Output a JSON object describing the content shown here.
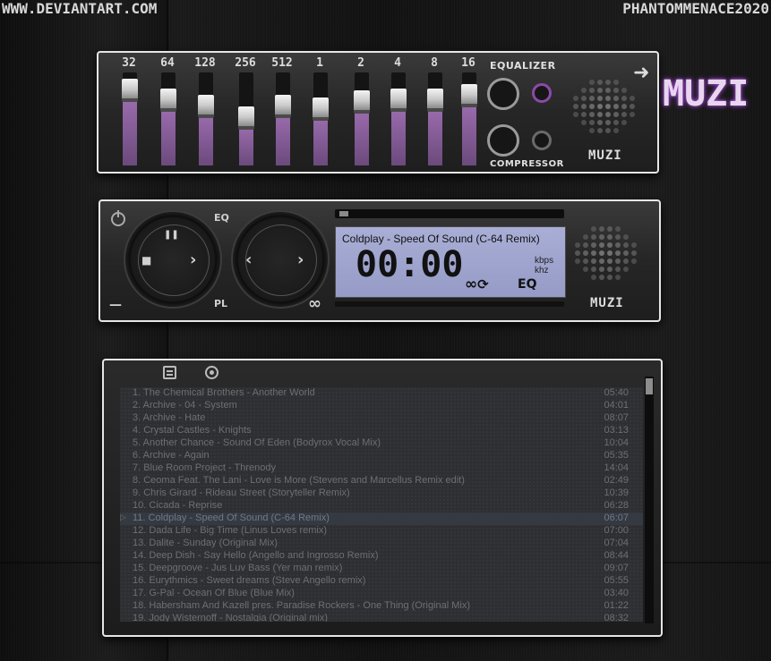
{
  "watermark": {
    "left": "WWW.DEVIANTART.COM",
    "right": "PHANTOMMENACE2020"
  },
  "logo": "MUZI",
  "equalizer": {
    "title": "EQUALIZER",
    "compressor_title": "COMPRESSOR",
    "brand": "MUZI",
    "bands": [
      {
        "label": "32",
        "level": 0.72
      },
      {
        "label": "64",
        "level": 0.62
      },
      {
        "label": "128",
        "level": 0.55
      },
      {
        "label": "256",
        "level": 0.42
      },
      {
        "label": "512",
        "level": 0.55
      },
      {
        "label": "1",
        "level": 0.52
      },
      {
        "label": "2",
        "level": 0.6
      },
      {
        "label": "4",
        "level": 0.62
      },
      {
        "label": "8",
        "level": 0.62
      },
      {
        "label": "16",
        "level": 0.66
      }
    ]
  },
  "player": {
    "eq_label": "EQ",
    "pl_label": "PL",
    "brand": "MUZI",
    "track_title": "Coldplay - Speed Of Sound (C-64 Remix)",
    "time": "00:00",
    "kbps": "kbps",
    "khz": "khz",
    "lcd_eq": "EQ",
    "loop_symbol": "∞",
    "repeat_symbol": "⟳",
    "pause_symbol": "❚❚",
    "stop_symbol": "■",
    "next_symbol": "›",
    "prev_symbol": "‹",
    "infinity_symbol": "∞",
    "minimize_symbol": "—"
  },
  "playlist": {
    "tracks": [
      {
        "title": "1. The Chemical Brothers - Another World",
        "duration": "05:40"
      },
      {
        "title": "2. Archive - 04 - System",
        "duration": "04:01"
      },
      {
        "title": "3. Archive - Hate",
        "duration": "08:07"
      },
      {
        "title": "4. Crystal Castles - Knights",
        "duration": "03:13"
      },
      {
        "title": "5. Another Chance - Sound Of Eden (Bodyrox Vocal Mix)",
        "duration": "10:04"
      },
      {
        "title": "6. Archive - Again",
        "duration": "05:35"
      },
      {
        "title": "7. Blue Room Project - Threnody",
        "duration": "14:04"
      },
      {
        "title": "8. Ceoma Feat. The Lani - Love is More (Stevens and Marcellus Remix edit)",
        "duration": "02:49"
      },
      {
        "title": "9. Chris Girard - Rideau Street (Storyteller Remix)",
        "duration": "10:39"
      },
      {
        "title": "10. Cicada - Reprise",
        "duration": "06:28"
      },
      {
        "title": "11. Coldplay - Speed Of Sound (C-64 Remix)",
        "duration": "06:07",
        "active": true
      },
      {
        "title": "12. Dada Life - Big Time (Linus Loves remix)",
        "duration": "07:00"
      },
      {
        "title": "13. Dalite - Sunday (Original Mix)",
        "duration": "07:04"
      },
      {
        "title": "14. Deep Dish - Say Hello (Angello and Ingrosso Remix)",
        "duration": "08:44"
      },
      {
        "title": "15. Deepgroove - Jus Luv Bass (Yer man remix)",
        "duration": "09:07"
      },
      {
        "title": "16. Eurythmics - Sweet dreams (Steve Angello remix)",
        "duration": "05:55"
      },
      {
        "title": "17. G-Pal - Ocean Of Blue (Blue Mix)",
        "duration": "03:40"
      },
      {
        "title": "18. Habersham And Kazell pres. Paradise Rockers - One Thing (Original Mix)",
        "duration": "01:22"
      },
      {
        "title": "19. Jody Wisternoff - Nostalgia (Original mix)",
        "duration": "08:32"
      }
    ]
  }
}
